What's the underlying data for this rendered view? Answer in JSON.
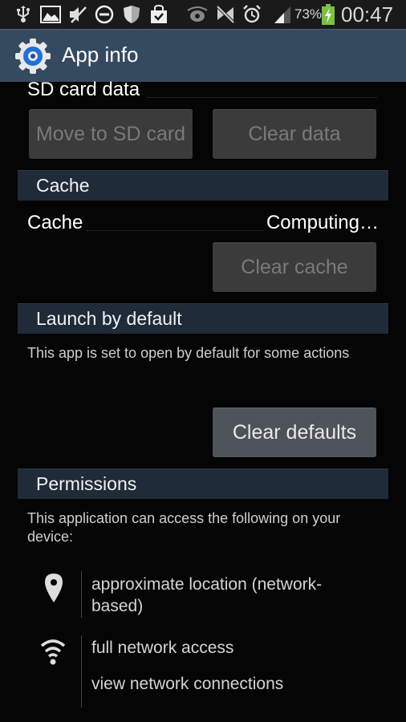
{
  "status_bar": {
    "left_icons": [
      "usb-icon",
      "gallery-icon",
      "mute-icon",
      "do-not-disturb-icon",
      "shield-icon",
      "shopping-bag-check-icon"
    ],
    "right_icons": [
      "smart-stay-eye-icon",
      "vibrate-off-icon",
      "alarm-icon",
      "signal-icon",
      "battery-charging-icon"
    ],
    "battery_percent": "73%",
    "time": "00:47"
  },
  "action_bar": {
    "icon": "settings-gear-icon",
    "title": "App info"
  },
  "storage": {
    "sd_card_label": "SD card data",
    "move_button": "Move to SD card",
    "clear_data_button": "Clear data"
  },
  "cache": {
    "section_title": "Cache",
    "label": "Cache",
    "value": "Computing…",
    "clear_button": "Clear cache"
  },
  "launch": {
    "section_title": "Launch by default",
    "description": "This app is set to open by default for some actions",
    "clear_button": "Clear defaults"
  },
  "permissions": {
    "section_title": "Permissions",
    "description": "This application can access the following on your device:",
    "groups": [
      {
        "icon": "location-pin-icon",
        "items": [
          "approximate location (network-based)"
        ]
      },
      {
        "icon": "wifi-icon",
        "items": [
          "full network access",
          "view network connections"
        ]
      }
    ]
  },
  "colors": {
    "action_bar": "#354a5f",
    "section_header": "#1f2b38",
    "background": "#050505",
    "battery": "#7ac142",
    "app_icon_blue": "#1e6fd9"
  }
}
